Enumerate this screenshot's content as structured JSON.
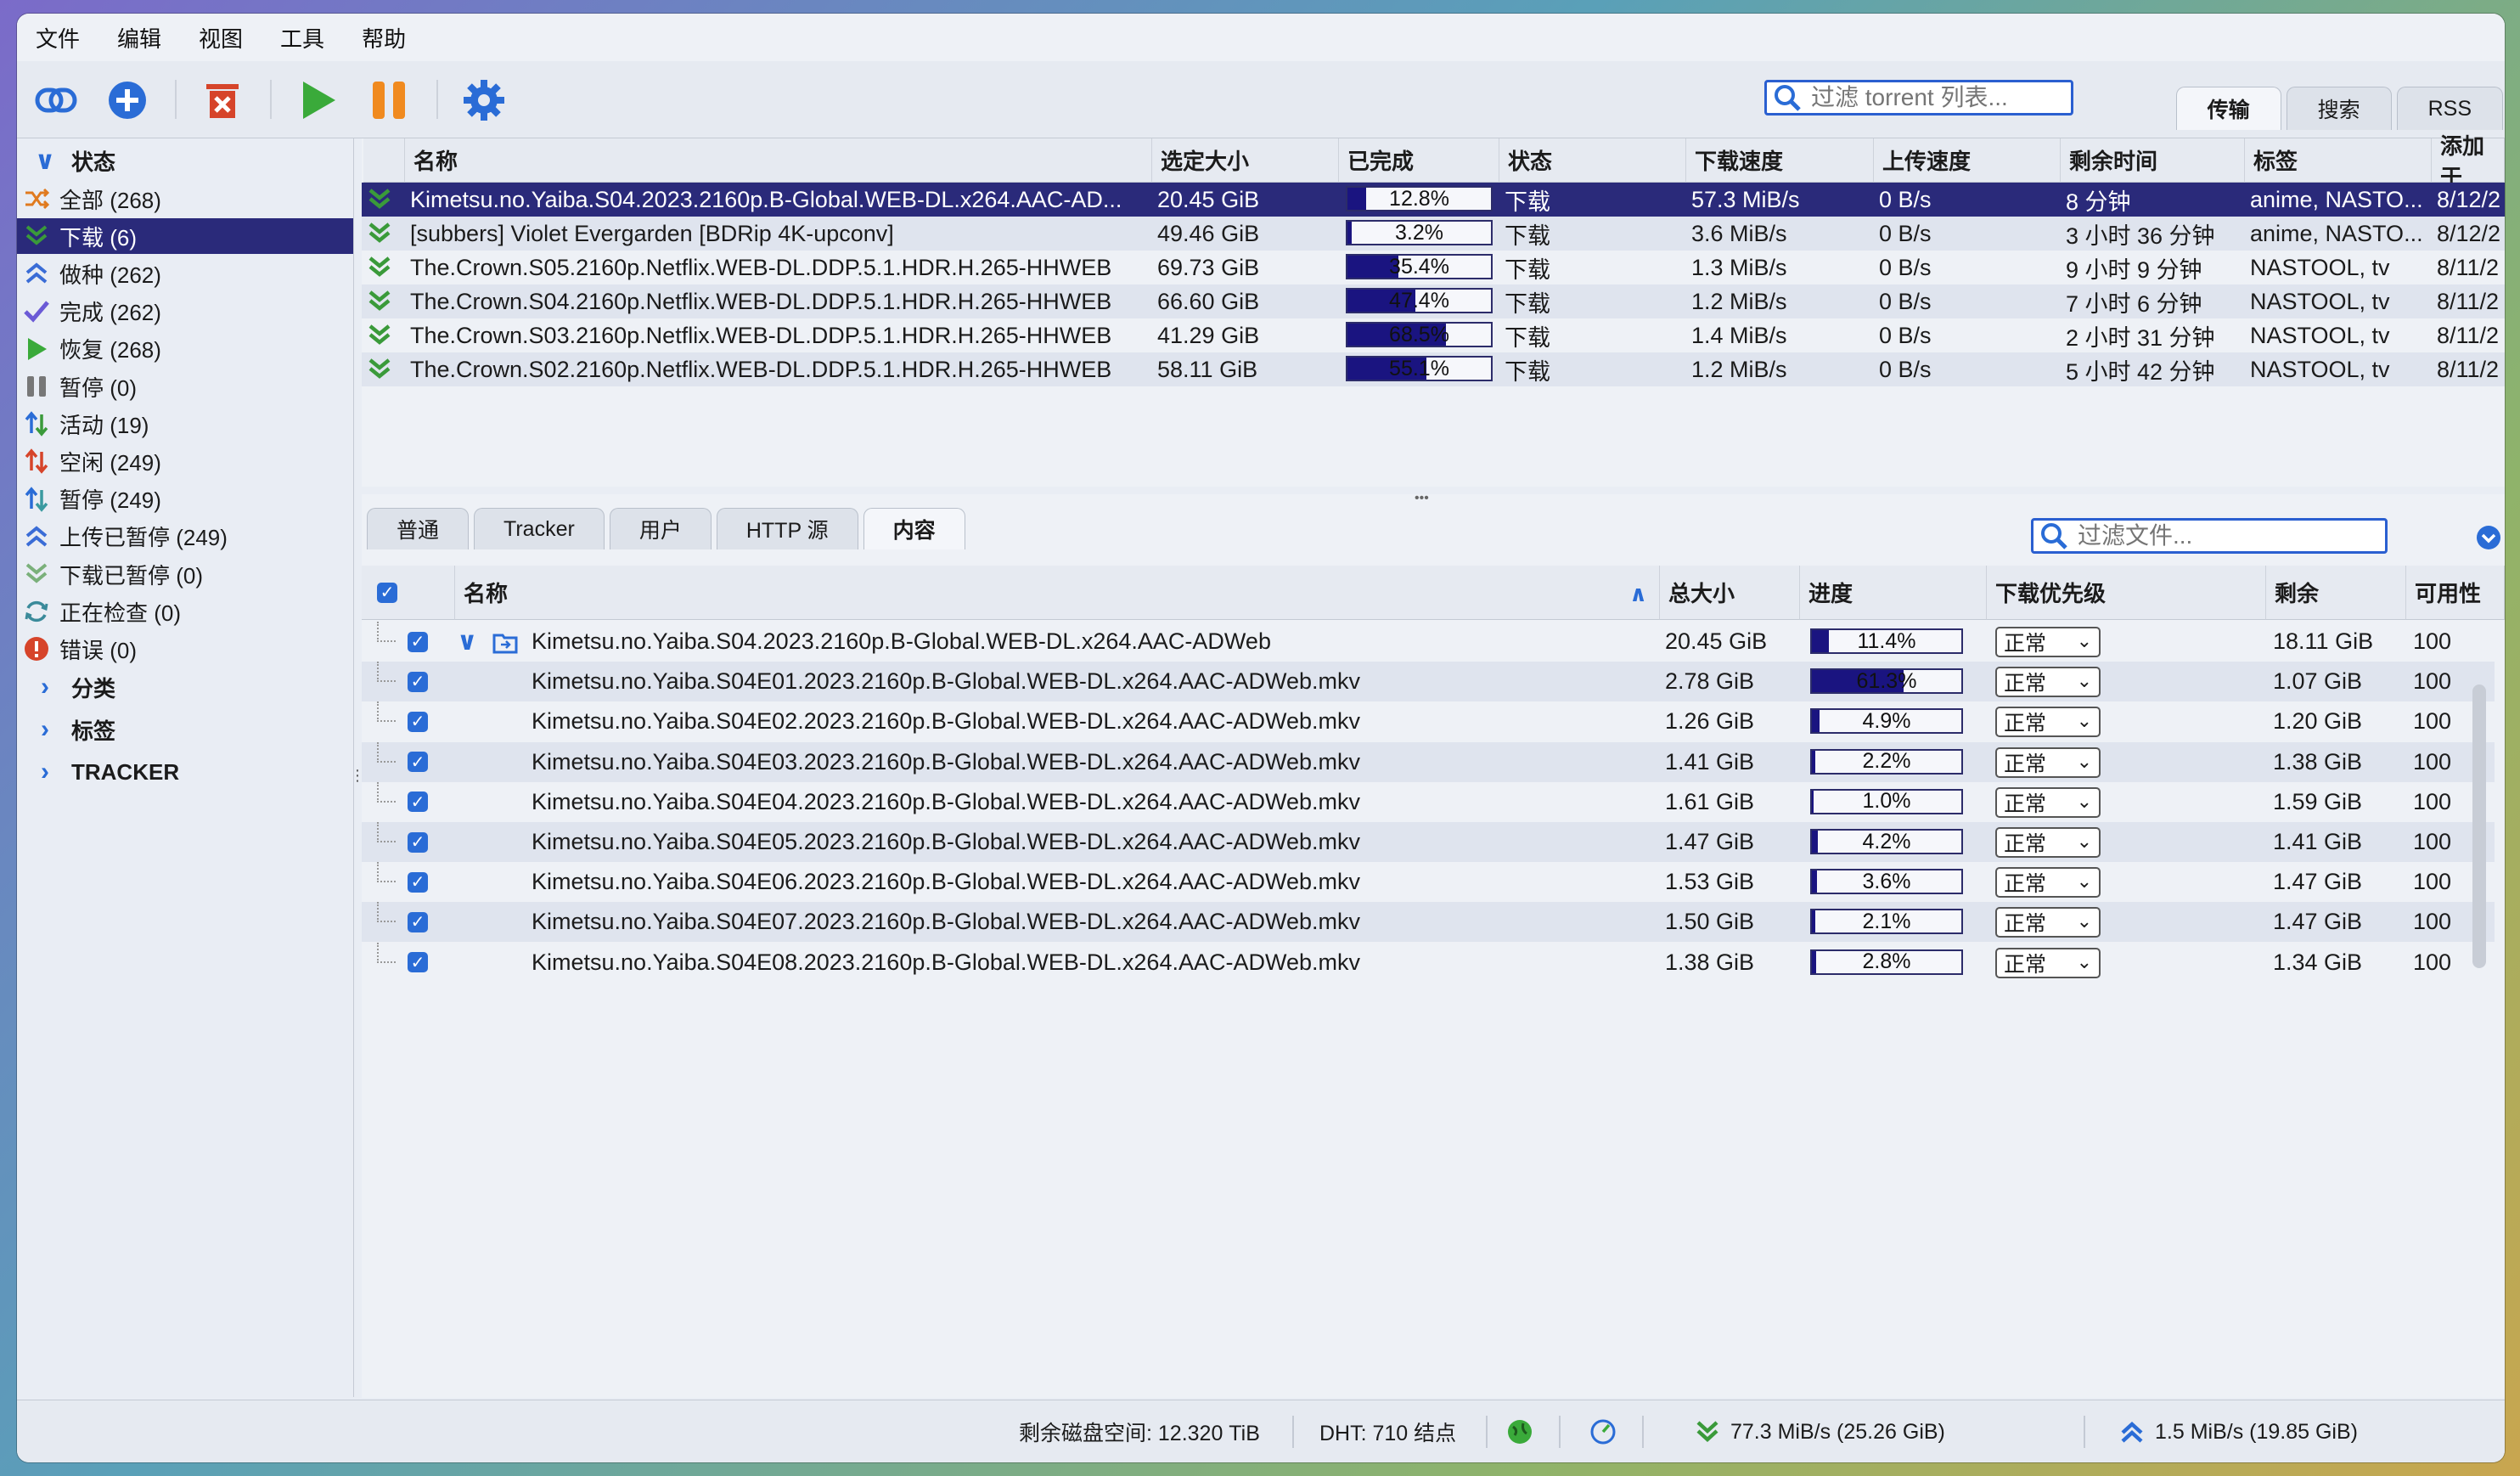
{
  "menu": [
    "文件",
    "编辑",
    "视图",
    "工具",
    "帮助"
  ],
  "toolbar": {
    "search_placeholder": "过滤 torrent 列表...",
    "icons": [
      "link-icon",
      "add-icon",
      "delete-icon",
      "resume-icon",
      "pause-icon",
      "settings-icon"
    ]
  },
  "view_tabs": [
    "传输",
    "搜索",
    "RSS"
  ],
  "sidebar": {
    "status_header": "状态",
    "items": [
      {
        "label": "全部 (268)",
        "icon": "shuffle-icon",
        "color": "#e07a1f"
      },
      {
        "label": "下载 (6)",
        "icon": "download-chevron-icon",
        "color": "#3a9a3a"
      },
      {
        "label": "做种 (262)",
        "icon": "upload-chevron-icon",
        "color": "#3a6cd6"
      },
      {
        "label": "完成 (262)",
        "icon": "check-icon",
        "color": "#6b5ad6"
      },
      {
        "label": "恢复 (268)",
        "icon": "play-icon",
        "color": "#3aaa3a"
      },
      {
        "label": "暂停 (0)",
        "icon": "pause-icon",
        "color": "#777777"
      },
      {
        "label": "活动 (19)",
        "icon": "updown-arrows-icon",
        "color": "#3a9a3a"
      },
      {
        "label": "空闲 (249)",
        "icon": "updown-arrows-red-icon",
        "color": "#d6442a"
      },
      {
        "label": "暂停 (249)",
        "icon": "updown-arrows-blue-icon",
        "color": "#3a9aa0"
      },
      {
        "label": "上传已暂停 (249)",
        "icon": "upload-chevron-icon",
        "color": "#3a6cd6"
      },
      {
        "label": "下载已暂停 (0)",
        "icon": "download-chevron-icon",
        "color": "#7ab07a"
      },
      {
        "label": "正在检查 (0)",
        "icon": "refresh-icon",
        "color": "#3a8a9a"
      },
      {
        "label": "错误 (0)",
        "icon": "error-icon",
        "color": "#d6442a"
      }
    ],
    "sections": [
      "分类",
      "标签",
      "TRACKER"
    ]
  },
  "torrents": {
    "columns": [
      "名称",
      "选定大小",
      "已完成",
      "状态",
      "下载速度",
      "上传速度",
      "剩余时间",
      "标签",
      "添加于"
    ],
    "rows": [
      {
        "name": "Kimetsu.no.Yaiba.S04.2023.2160p.B-Global.WEB-DL.x264.AAC-AD...",
        "size": "20.45 GiB",
        "progress": 0.128,
        "progress_label": "12.8%",
        "status": "下载",
        "dl": "57.3 MiB/s",
        "ul": "0 B/s",
        "eta": "8 分钟",
        "tags": "anime, NASTO...",
        "added": "8/12/2"
      },
      {
        "name": "[subbers] Violet Evergarden [BDRip 4K-upconv]",
        "size": "49.46 GiB",
        "progress": 0.032,
        "progress_label": "3.2%",
        "status": "下载",
        "dl": "3.6 MiB/s",
        "ul": "0 B/s",
        "eta": "3 小时 36 分钟",
        "tags": "anime, NASTO...",
        "added": "8/12/2"
      },
      {
        "name": "The.Crown.S05.2160p.Netflix.WEB-DL.DDP.5.1.HDR.H.265-HHWEB",
        "size": "69.73 GiB",
        "progress": 0.354,
        "progress_label": "35.4%",
        "status": "下载",
        "dl": "1.3 MiB/s",
        "ul": "0 B/s",
        "eta": "9 小时 9 分钟",
        "tags": "NASTOOL, tv",
        "added": "8/11/2"
      },
      {
        "name": "The.Crown.S04.2160p.Netflix.WEB-DL.DDP.5.1.HDR.H.265-HHWEB",
        "size": "66.60 GiB",
        "progress": 0.474,
        "progress_label": "47.4%",
        "status": "下载",
        "dl": "1.2 MiB/s",
        "ul": "0 B/s",
        "eta": "7 小时 6 分钟",
        "tags": "NASTOOL, tv",
        "added": "8/11/2"
      },
      {
        "name": "The.Crown.S03.2160p.Netflix.WEB-DL.DDP.5.1.HDR.H.265-HHWEB",
        "size": "41.29 GiB",
        "progress": 0.685,
        "progress_label": "68.5%",
        "status": "下载",
        "dl": "1.4 MiB/s",
        "ul": "0 B/s",
        "eta": "2 小时 31 分钟",
        "tags": "NASTOOL, tv",
        "added": "8/11/2"
      },
      {
        "name": "The.Crown.S02.2160p.Netflix.WEB-DL.DDP.5.1.HDR.H.265-HHWEB",
        "size": "58.11 GiB",
        "progress": 0.551,
        "progress_label": "55.1%",
        "status": "下载",
        "dl": "1.2 MiB/s",
        "ul": "0 B/s",
        "eta": "5 小时 42 分钟",
        "tags": "NASTOOL, tv",
        "added": "8/11/2"
      }
    ]
  },
  "detail_tabs": [
    "普通",
    "Tracker",
    "用户",
    "HTTP 源",
    "内容"
  ],
  "files": {
    "search_placeholder": "过滤文件...",
    "columns": [
      "名称",
      "总大小",
      "进度",
      "下载优先级",
      "剩余",
      "可用性"
    ],
    "rows": [
      {
        "name": "Kimetsu.no.Yaiba.S04.2023.2160p.B-Global.WEB-DL.x264.AAC-ADWeb",
        "size": "20.45 GiB",
        "progress": 0.114,
        "progress_label": "11.4%",
        "priority": "正常",
        "remaining": "18.11 GiB",
        "avail": "100",
        "folder": true
      },
      {
        "name": "Kimetsu.no.Yaiba.S04E01.2023.2160p.B-Global.WEB-DL.x264.AAC-ADWeb.mkv",
        "size": "2.78 GiB",
        "progress": 0.613,
        "progress_label": "61.3%",
        "priority": "正常",
        "remaining": "1.07 GiB",
        "avail": "100"
      },
      {
        "name": "Kimetsu.no.Yaiba.S04E02.2023.2160p.B-Global.WEB-DL.x264.AAC-ADWeb.mkv",
        "size": "1.26 GiB",
        "progress": 0.049,
        "progress_label": "4.9%",
        "priority": "正常",
        "remaining": "1.20 GiB",
        "avail": "100"
      },
      {
        "name": "Kimetsu.no.Yaiba.S04E03.2023.2160p.B-Global.WEB-DL.x264.AAC-ADWeb.mkv",
        "size": "1.41 GiB",
        "progress": 0.022,
        "progress_label": "2.2%",
        "priority": "正常",
        "remaining": "1.38 GiB",
        "avail": "100"
      },
      {
        "name": "Kimetsu.no.Yaiba.S04E04.2023.2160p.B-Global.WEB-DL.x264.AAC-ADWeb.mkv",
        "size": "1.61 GiB",
        "progress": 0.01,
        "progress_label": "1.0%",
        "priority": "正常",
        "remaining": "1.59 GiB",
        "avail": "100"
      },
      {
        "name": "Kimetsu.no.Yaiba.S04E05.2023.2160p.B-Global.WEB-DL.x264.AAC-ADWeb.mkv",
        "size": "1.47 GiB",
        "progress": 0.042,
        "progress_label": "4.2%",
        "priority": "正常",
        "remaining": "1.41 GiB",
        "avail": "100"
      },
      {
        "name": "Kimetsu.no.Yaiba.S04E06.2023.2160p.B-Global.WEB-DL.x264.AAC-ADWeb.mkv",
        "size": "1.53 GiB",
        "progress": 0.036,
        "progress_label": "3.6%",
        "priority": "正常",
        "remaining": "1.47 GiB",
        "avail": "100"
      },
      {
        "name": "Kimetsu.no.Yaiba.S04E07.2023.2160p.B-Global.WEB-DL.x264.AAC-ADWeb.mkv",
        "size": "1.50 GiB",
        "progress": 0.021,
        "progress_label": "2.1%",
        "priority": "正常",
        "remaining": "1.47 GiB",
        "avail": "100"
      },
      {
        "name": "Kimetsu.no.Yaiba.S04E08.2023.2160p.B-Global.WEB-DL.x264.AAC-ADWeb.mkv",
        "size": "1.38 GiB",
        "progress": 0.028,
        "progress_label": "2.8%",
        "priority": "正常",
        "remaining": "1.34 GiB",
        "avail": "100"
      }
    ]
  },
  "statusbar": {
    "disk": "剩余磁盘空间: 12.320 TiB",
    "dht": "DHT: 710 结点",
    "dl": "77.3 MiB/s (25.26 GiB)",
    "ul": "1.5 MiB/s (19.85 GiB)"
  }
}
